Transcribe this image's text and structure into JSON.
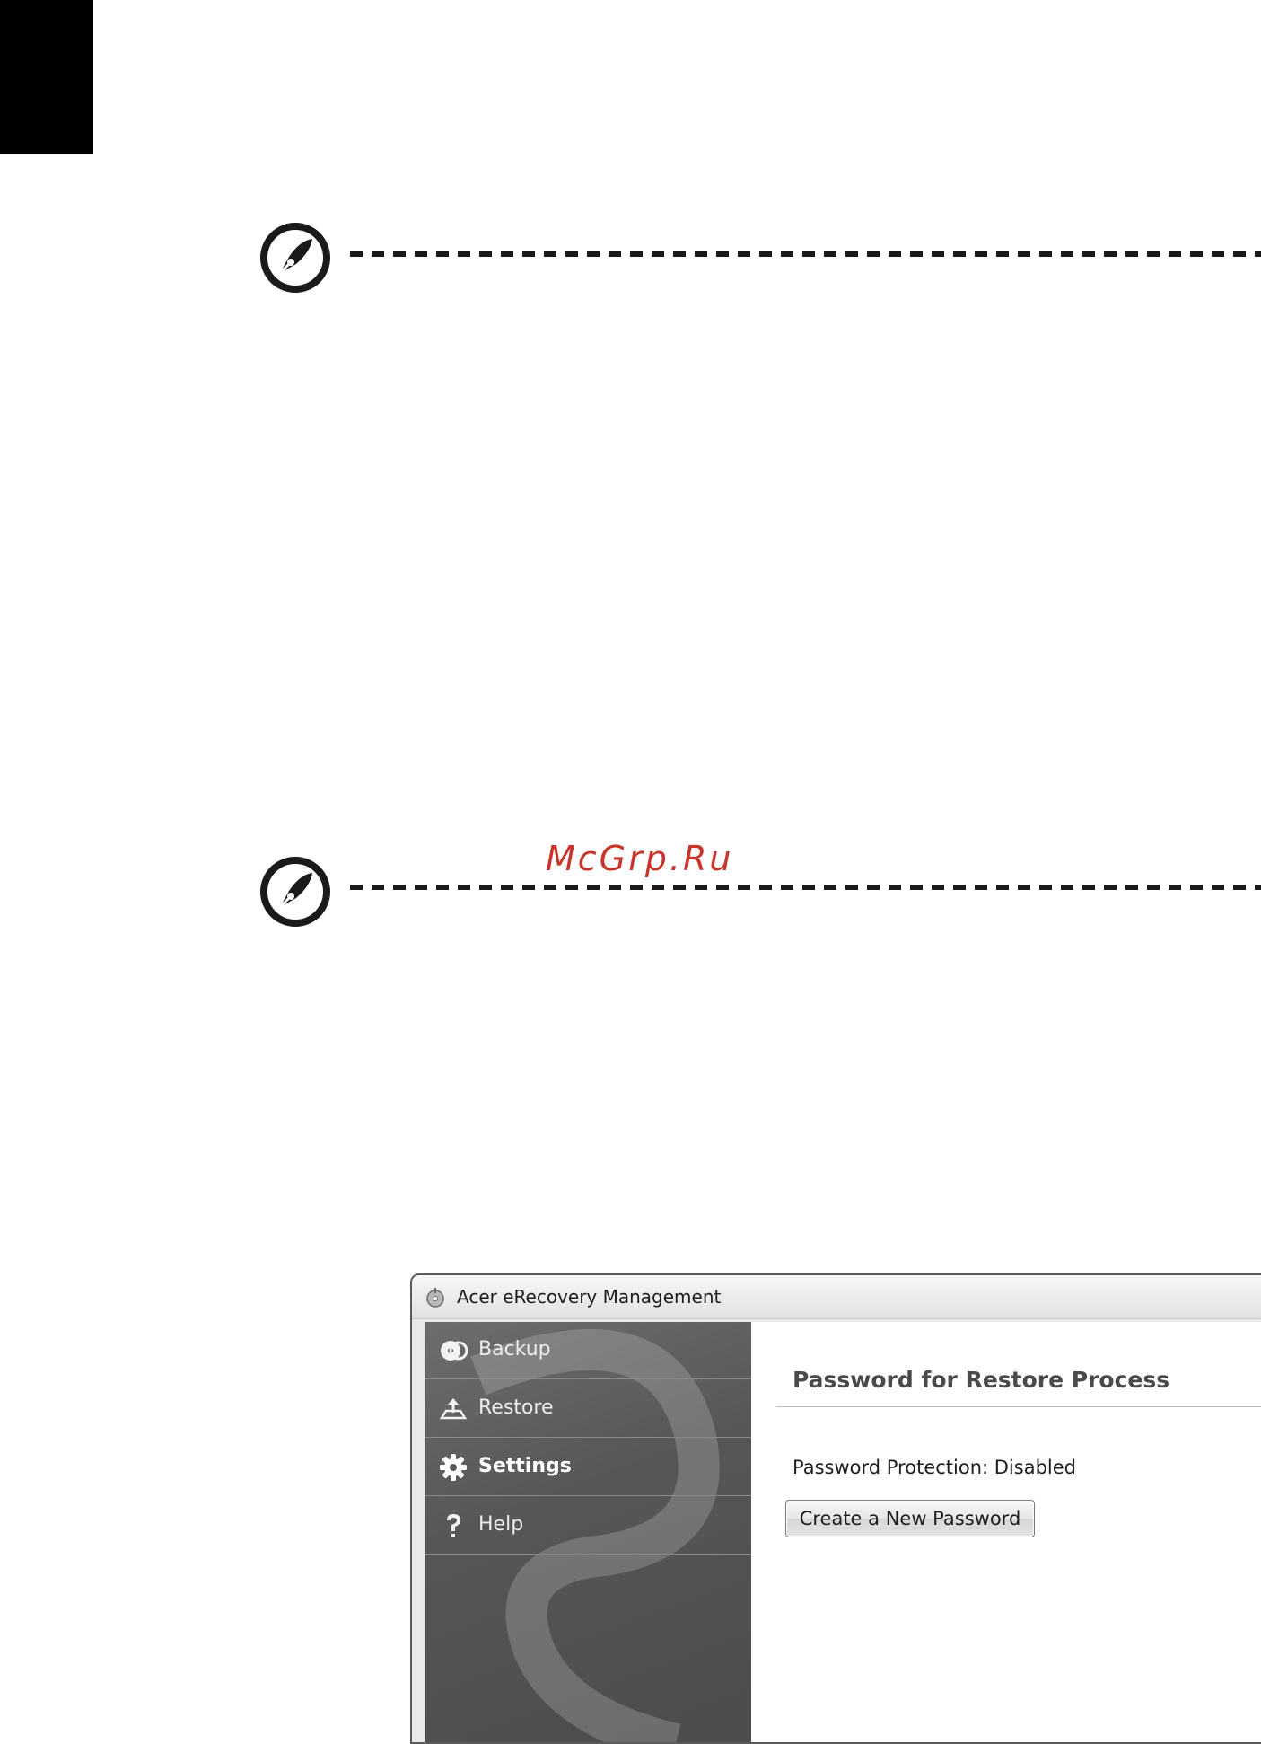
{
  "watermark": "McGrp.Ru",
  "window": {
    "title": "Acer eRecovery Management",
    "nav": [
      {
        "label": "Backup",
        "icon": "backup-disc-icon"
      },
      {
        "label": "Restore",
        "icon": "restore-icon"
      },
      {
        "label": "Settings",
        "icon": "gear-icon",
        "active": true
      },
      {
        "label": "Help",
        "icon": "question-icon"
      }
    ],
    "content": {
      "section_title": "Password for Restore Process",
      "status": "Password Protection: Disabled",
      "button_label": "Create a New Password"
    }
  },
  "colors": {
    "watermark": "#c8352b",
    "sidebar": "#575757",
    "tab_marker": "#000000"
  }
}
